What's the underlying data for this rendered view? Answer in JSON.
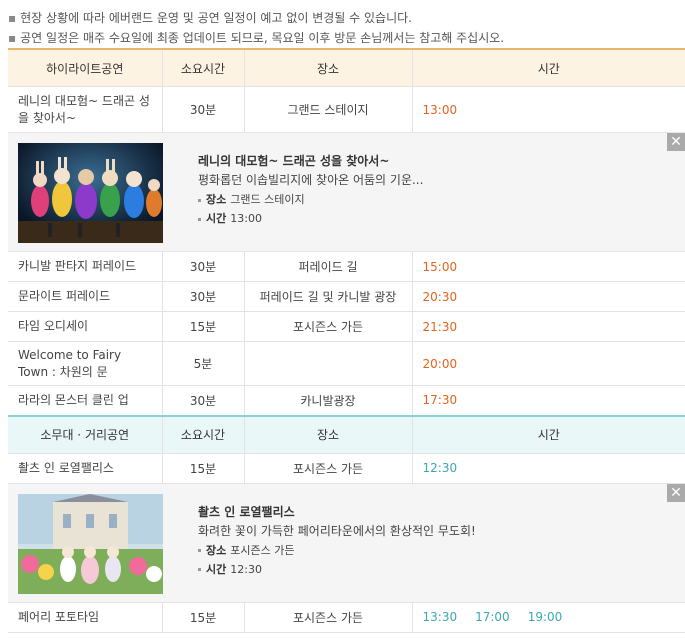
{
  "notices": [
    "현장 상황에 따라 에버랜드 운영 및 공연 일정이 예고 없이 변경될 수 있습니다.",
    "공연 일정은 매주 수요일에 최종 업데이트 되므로, 목요일 이후 방문 손님께서는 참고해 주십시오."
  ],
  "headers1": [
    "하이라이트공연",
    "소요시간",
    "장소",
    "시간"
  ],
  "headers2": [
    "소무대 · 거리공연",
    "소요시간",
    "장소",
    "시간"
  ],
  "shows1": [
    {
      "name": "레니의 대모험~ 드래곤 성을 찾아서~",
      "dur": "30분",
      "place": "그랜드 스테이지",
      "time": "13:00"
    },
    {
      "name": "카니발 판타지 퍼레이드",
      "dur": "30분",
      "place": "퍼레이드 길",
      "time": "15:00"
    },
    {
      "name": "문라이트 퍼레이드",
      "dur": "30분",
      "place": "퍼레이드 길 및 카니발 광장",
      "time": "20:30"
    },
    {
      "name": "타임 오디세이",
      "dur": "15분",
      "place": "포시즌스 가든",
      "time": "21:30"
    },
    {
      "name": "Welcome to Fairy Town : 차원의 문",
      "dur": "5분",
      "place": "",
      "time": "20:00"
    },
    {
      "name": "라라의 몬스터 클린 업",
      "dur": "30분",
      "place": "카니발광장",
      "time": "17:30"
    }
  ],
  "detail1": {
    "title": "레니의 대모험~ 드래곤 성을 찾아서~",
    "desc": "평화롭던 이솝빌리지에 찾아온 어둠의 기운...",
    "place_label": "장소",
    "place": "그랜드 스테이지",
    "time_label": "시간",
    "time": "13:00"
  },
  "shows2": [
    {
      "name": "촬츠 인 로열팰리스",
      "dur": "15분",
      "place": "포시즌스 가든",
      "times": [
        "12:30"
      ]
    },
    {
      "name": "페어리 포토타임",
      "dur": "15분",
      "place": "포시즌스 가든",
      "times": [
        "13:30",
        "17:00",
        "19:00"
      ]
    }
  ],
  "detail2": {
    "title": "촬츠 인 로열팰리스",
    "desc": "화려한 꽃이 가득한 페어리타운에서의 환상적인 무도회!",
    "place_label": "장소",
    "place": "포시즌스 가든",
    "time_label": "시간",
    "time": "12:30"
  },
  "icons": {
    "bullet": "bullet-icon",
    "close": "close-icon"
  },
  "colors": {
    "orange_time": "#e2641e",
    "teal_time": "#3aa8ae",
    "head_orange": "#fdf3e3",
    "head_teal": "#e9f7f8"
  }
}
